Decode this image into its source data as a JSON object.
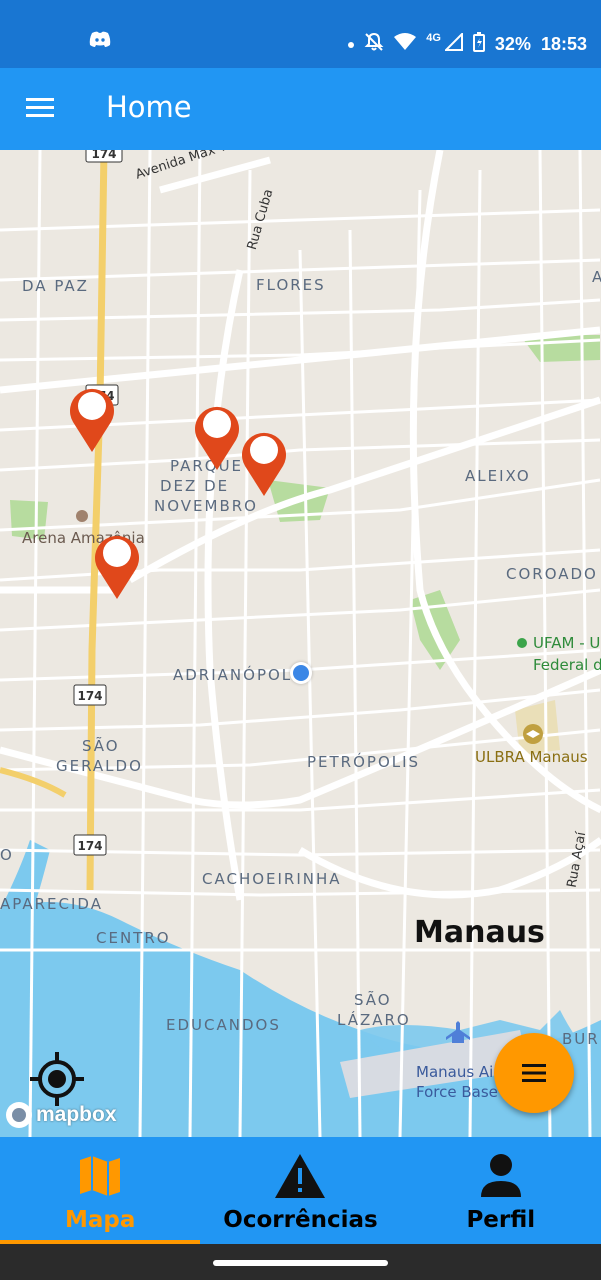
{
  "status_bar": {
    "network": "4G",
    "battery": "32%",
    "time": "18:53",
    "icons": [
      "discord-icon",
      "dot-icon",
      "mute-icon",
      "wifi-icon",
      "signal-icon",
      "battery-icon"
    ]
  },
  "app_bar": {
    "title": "Home",
    "menu_icon": "hamburger-menu-icon"
  },
  "map": {
    "labels": {
      "da_paz": "DA PAZ",
      "flores": "FLORES",
      "parque_dez_1": "PARQUE",
      "parque_dez_2": "DEZ DE",
      "parque_dez_3": "NOVEMBRO",
      "aleixo": "ALEIXO",
      "coroado": "COROADO",
      "adrianopolis": "ADRIANÓPOLIS",
      "sao_geraldo_1": "SÃO",
      "sao_geraldo_2": "GERALDO",
      "petropolis": "PETRÓPOLIS",
      "cachoeirinha": "CACHOEIRINHA",
      "aparecida": "APARECIDA",
      "centro": "CENTRO",
      "educandos": "EDUCANDOS",
      "sao_lazaro_1": "SÃO",
      "sao_lazaro_2": "LÁZARO",
      "buri": "BURI",
      "o_left": "O",
      "a_right": "A"
    },
    "city": "Manaus",
    "streets": {
      "max_teixeira": "Avenida Max Teixe",
      "rua_cuba": "Rua Cuba",
      "rua_acai": "Rua Açaí"
    },
    "pois": {
      "arena": "Arena Amazônia",
      "ufam_1": "UFAM - U",
      "ufam_2": "Federal d",
      "ulbra": "ULBRA Manaus",
      "airforce_1": "Manaus Ai",
      "airforce_2": "Force Base"
    },
    "road_shields": [
      "174",
      "174",
      "174",
      "174"
    ],
    "attribution": "mapbox",
    "colors": {
      "land": "#ece8e1",
      "road": "#ffffff",
      "highway": "#f3cf6b",
      "water": "#7cc9ee",
      "park": "#b7dc9f",
      "pin": "#e0481b"
    }
  },
  "fab": {
    "icon": "menu-icon"
  },
  "bottom_nav": {
    "items": [
      {
        "label": "Mapa",
        "icon": "map-icon",
        "active": true
      },
      {
        "label": "Ocorrências",
        "icon": "warning-icon",
        "active": false
      },
      {
        "label": "Perfil",
        "icon": "person-icon",
        "active": false
      }
    ]
  }
}
